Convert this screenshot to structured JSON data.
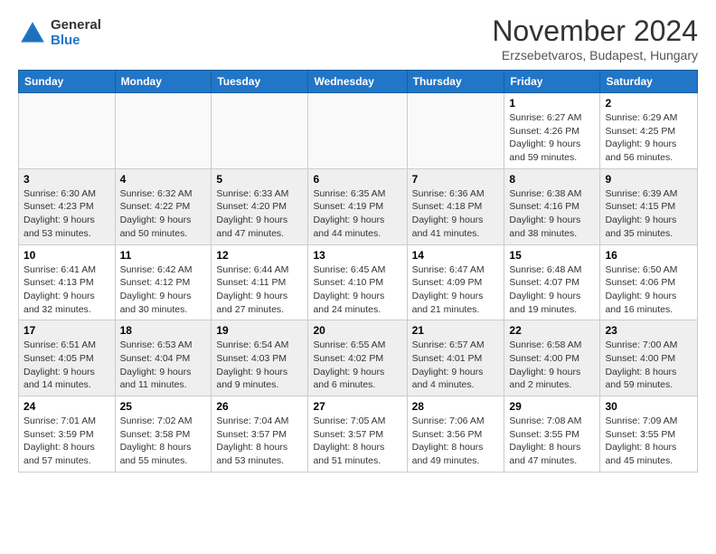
{
  "logo": {
    "general": "General",
    "blue": "Blue"
  },
  "title": "November 2024",
  "location": "Erzsebetvaros, Budapest, Hungary",
  "days_of_week": [
    "Sunday",
    "Monday",
    "Tuesday",
    "Wednesday",
    "Thursday",
    "Friday",
    "Saturday"
  ],
  "weeks": [
    [
      {
        "day": "",
        "info": ""
      },
      {
        "day": "",
        "info": ""
      },
      {
        "day": "",
        "info": ""
      },
      {
        "day": "",
        "info": ""
      },
      {
        "day": "",
        "info": ""
      },
      {
        "day": "1",
        "info": "Sunrise: 6:27 AM\nSunset: 4:26 PM\nDaylight: 9 hours\nand 59 minutes."
      },
      {
        "day": "2",
        "info": "Sunrise: 6:29 AM\nSunset: 4:25 PM\nDaylight: 9 hours\nand 56 minutes."
      }
    ],
    [
      {
        "day": "3",
        "info": "Sunrise: 6:30 AM\nSunset: 4:23 PM\nDaylight: 9 hours\nand 53 minutes."
      },
      {
        "day": "4",
        "info": "Sunrise: 6:32 AM\nSunset: 4:22 PM\nDaylight: 9 hours\nand 50 minutes."
      },
      {
        "day": "5",
        "info": "Sunrise: 6:33 AM\nSunset: 4:20 PM\nDaylight: 9 hours\nand 47 minutes."
      },
      {
        "day": "6",
        "info": "Sunrise: 6:35 AM\nSunset: 4:19 PM\nDaylight: 9 hours\nand 44 minutes."
      },
      {
        "day": "7",
        "info": "Sunrise: 6:36 AM\nSunset: 4:18 PM\nDaylight: 9 hours\nand 41 minutes."
      },
      {
        "day": "8",
        "info": "Sunrise: 6:38 AM\nSunset: 4:16 PM\nDaylight: 9 hours\nand 38 minutes."
      },
      {
        "day": "9",
        "info": "Sunrise: 6:39 AM\nSunset: 4:15 PM\nDaylight: 9 hours\nand 35 minutes."
      }
    ],
    [
      {
        "day": "10",
        "info": "Sunrise: 6:41 AM\nSunset: 4:13 PM\nDaylight: 9 hours\nand 32 minutes."
      },
      {
        "day": "11",
        "info": "Sunrise: 6:42 AM\nSunset: 4:12 PM\nDaylight: 9 hours\nand 30 minutes."
      },
      {
        "day": "12",
        "info": "Sunrise: 6:44 AM\nSunset: 4:11 PM\nDaylight: 9 hours\nand 27 minutes."
      },
      {
        "day": "13",
        "info": "Sunrise: 6:45 AM\nSunset: 4:10 PM\nDaylight: 9 hours\nand 24 minutes."
      },
      {
        "day": "14",
        "info": "Sunrise: 6:47 AM\nSunset: 4:09 PM\nDaylight: 9 hours\nand 21 minutes."
      },
      {
        "day": "15",
        "info": "Sunrise: 6:48 AM\nSunset: 4:07 PM\nDaylight: 9 hours\nand 19 minutes."
      },
      {
        "day": "16",
        "info": "Sunrise: 6:50 AM\nSunset: 4:06 PM\nDaylight: 9 hours\nand 16 minutes."
      }
    ],
    [
      {
        "day": "17",
        "info": "Sunrise: 6:51 AM\nSunset: 4:05 PM\nDaylight: 9 hours\nand 14 minutes."
      },
      {
        "day": "18",
        "info": "Sunrise: 6:53 AM\nSunset: 4:04 PM\nDaylight: 9 hours\nand 11 minutes."
      },
      {
        "day": "19",
        "info": "Sunrise: 6:54 AM\nSunset: 4:03 PM\nDaylight: 9 hours\nand 9 minutes."
      },
      {
        "day": "20",
        "info": "Sunrise: 6:55 AM\nSunset: 4:02 PM\nDaylight: 9 hours\nand 6 minutes."
      },
      {
        "day": "21",
        "info": "Sunrise: 6:57 AM\nSunset: 4:01 PM\nDaylight: 9 hours\nand 4 minutes."
      },
      {
        "day": "22",
        "info": "Sunrise: 6:58 AM\nSunset: 4:00 PM\nDaylight: 9 hours\nand 2 minutes."
      },
      {
        "day": "23",
        "info": "Sunrise: 7:00 AM\nSunset: 4:00 PM\nDaylight: 8 hours\nand 59 minutes."
      }
    ],
    [
      {
        "day": "24",
        "info": "Sunrise: 7:01 AM\nSunset: 3:59 PM\nDaylight: 8 hours\nand 57 minutes."
      },
      {
        "day": "25",
        "info": "Sunrise: 7:02 AM\nSunset: 3:58 PM\nDaylight: 8 hours\nand 55 minutes."
      },
      {
        "day": "26",
        "info": "Sunrise: 7:04 AM\nSunset: 3:57 PM\nDaylight: 8 hours\nand 53 minutes."
      },
      {
        "day": "27",
        "info": "Sunrise: 7:05 AM\nSunset: 3:57 PM\nDaylight: 8 hours\nand 51 minutes."
      },
      {
        "day": "28",
        "info": "Sunrise: 7:06 AM\nSunset: 3:56 PM\nDaylight: 8 hours\nand 49 minutes."
      },
      {
        "day": "29",
        "info": "Sunrise: 7:08 AM\nSunset: 3:55 PM\nDaylight: 8 hours\nand 47 minutes."
      },
      {
        "day": "30",
        "info": "Sunrise: 7:09 AM\nSunset: 3:55 PM\nDaylight: 8 hours\nand 45 minutes."
      }
    ]
  ]
}
